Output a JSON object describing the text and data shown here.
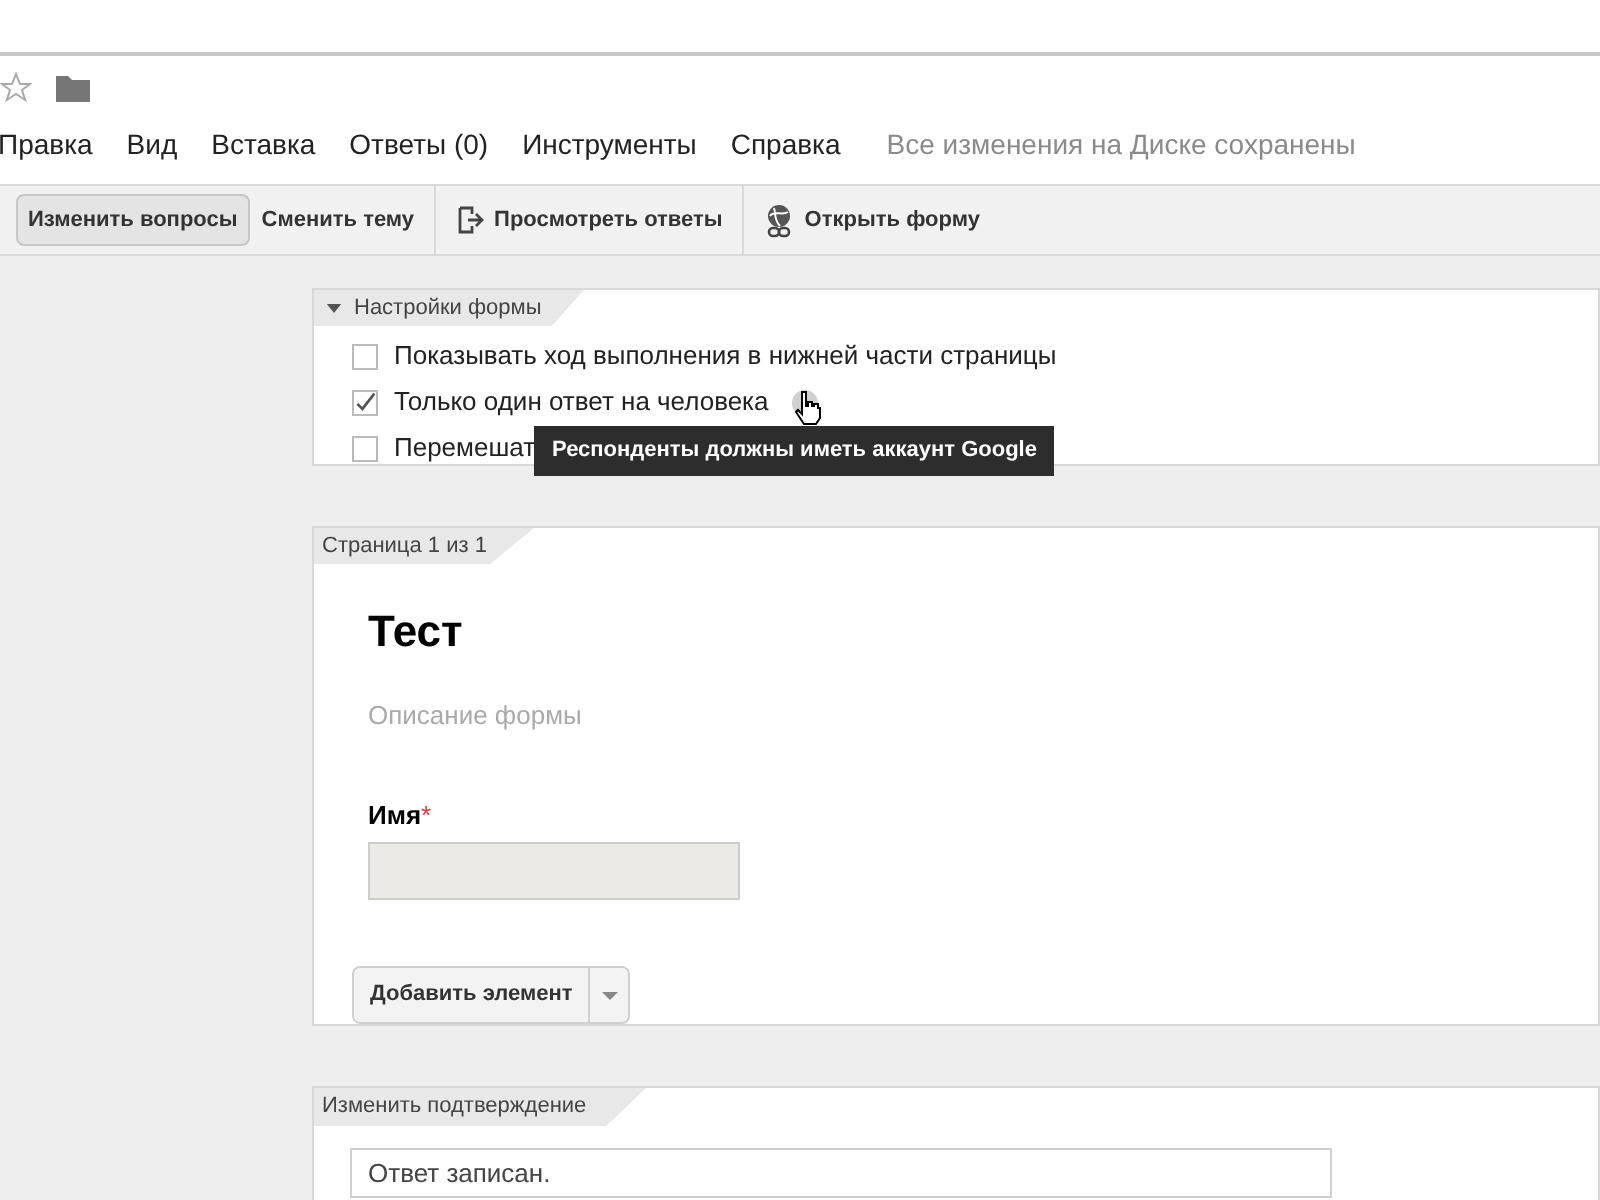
{
  "menu": [
    "Правка",
    "Вид",
    "Вставка",
    "Ответы (0)",
    "Инструменты",
    "Справка"
  ],
  "save_status": "Все изменения на Диске сохранены",
  "toolbar": [
    {
      "label": "Изменить вопросы",
      "selected": true,
      "kind": "text"
    },
    {
      "label": "Сменить тему",
      "selected": false,
      "kind": "text"
    },
    {
      "label": "Просмотреть ответы",
      "selected": false,
      "kind": "responses"
    },
    {
      "label": "Открыть форму",
      "selected": false,
      "kind": "globe"
    }
  ],
  "settings": {
    "title": "Настройки формы",
    "expanded": true,
    "options": [
      {
        "label": "Показывать ход выполнения в нижней части страницы",
        "checked": false
      },
      {
        "label": "Только один ответ на человека",
        "checked": true,
        "kind": "help"
      },
      {
        "label": "Перемешат",
        "checked": false
      }
    ],
    "tooltip": "Респонденты должны иметь аккаунт Google"
  },
  "page": {
    "tab": "Страница 1 из 1",
    "title": "Тест",
    "description": "Описание формы",
    "question": {
      "label": "Имя",
      "required_mark": "*"
    },
    "add_button": "Добавить элемент"
  },
  "confirmation": {
    "tab": "Изменить подтверждение",
    "value": "Ответ записан."
  }
}
